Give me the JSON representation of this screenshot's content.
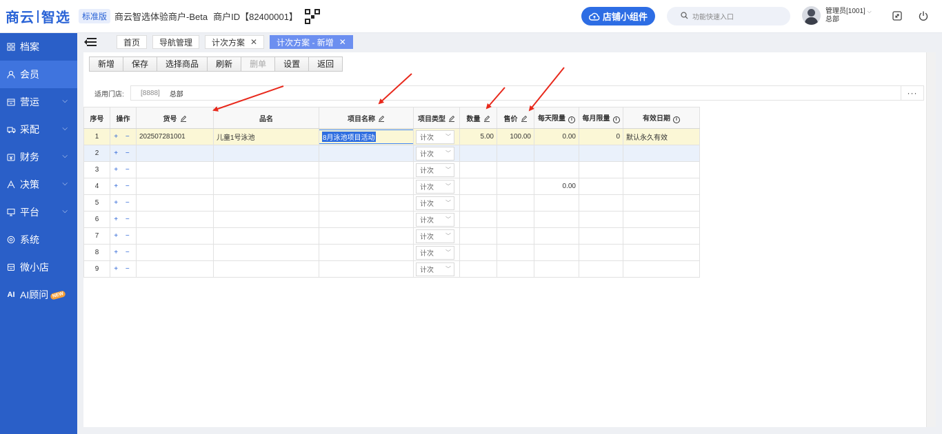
{
  "header": {
    "brand_left": "商云",
    "brand_right": "智选",
    "edition": "标准版",
    "merchant_name": "商云智选体验商户-Beta",
    "merchant_id": "商户ID【82400001】",
    "widget_button": "店铺小组件",
    "search_placeholder": "功能快速入口",
    "user_name": "管理员[1001]",
    "user_org": "总部"
  },
  "sidebar": {
    "items": [
      {
        "label": "档案",
        "icon": "archive-icon"
      },
      {
        "label": "会员",
        "icon": "member-icon"
      },
      {
        "label": "营运",
        "icon": "store-icon"
      },
      {
        "label": "采配",
        "icon": "truck-icon"
      },
      {
        "label": "财务",
        "icon": "wallet-icon"
      },
      {
        "label": "决策",
        "icon": "decision-icon"
      },
      {
        "label": "平台",
        "icon": "monitor-icon"
      },
      {
        "label": "系统",
        "icon": "gear-icon"
      },
      {
        "label": "微小店",
        "icon": "shop-icon"
      },
      {
        "label": "AI顾问",
        "icon": "ai-icon"
      }
    ],
    "new_badge": "NEW"
  },
  "tabs": [
    {
      "label": "首页"
    },
    {
      "label": "导航管理"
    },
    {
      "label": "计次方案"
    },
    {
      "label": "计次方案 - 新增"
    }
  ],
  "toolbar": {
    "buttons": [
      "新增",
      "保存",
      "选择商品",
      "刷新",
      "删单",
      "设置",
      "返回"
    ]
  },
  "store": {
    "label": "适用门店:",
    "code": "[8888]",
    "name": "总部",
    "more": "···"
  },
  "table": {
    "headers": [
      "序号",
      "操作",
      "货号",
      "品名",
      "项目名称",
      "项目类型",
      "数量",
      "售价",
      "每天限量",
      "每月限量",
      "有效日期"
    ],
    "ops": "+ −",
    "type_value": "计次",
    "rows": [
      {
        "no": "1",
        "sku": "202507281001",
        "name": "儿童1号泳池",
        "project": "8月泳池项目活动",
        "qty": "5.00",
        "price": "100.00",
        "daily": "0.00",
        "monthly": "0",
        "valid": "默认永久有效"
      },
      {
        "no": "2",
        "sku": "",
        "name": "",
        "project": "",
        "qty": "",
        "price": "",
        "daily": "",
        "monthly": "",
        "valid": ""
      },
      {
        "no": "3",
        "sku": "",
        "name": "",
        "project": "",
        "qty": "",
        "price": "",
        "daily": "",
        "monthly": "",
        "valid": ""
      },
      {
        "no": "4",
        "sku": "",
        "name": "",
        "project": "",
        "qty": "",
        "price": "",
        "daily": "0.00",
        "monthly": "",
        "valid": ""
      },
      {
        "no": "5",
        "sku": "",
        "name": "",
        "project": "",
        "qty": "",
        "price": "",
        "daily": "",
        "monthly": "",
        "valid": ""
      },
      {
        "no": "6",
        "sku": "",
        "name": "",
        "project": "",
        "qty": "",
        "price": "",
        "daily": "",
        "monthly": "",
        "valid": ""
      },
      {
        "no": "7",
        "sku": "",
        "name": "",
        "project": "",
        "qty": "",
        "price": "",
        "daily": "",
        "monthly": "",
        "valid": ""
      },
      {
        "no": "8",
        "sku": "",
        "name": "",
        "project": "",
        "qty": "",
        "price": "",
        "daily": "",
        "monthly": "",
        "valid": ""
      },
      {
        "no": "9",
        "sku": "",
        "name": "",
        "project": "",
        "qty": "",
        "price": "",
        "daily": "",
        "monthly": "",
        "valid": ""
      }
    ]
  },
  "colors": {
    "brand": "#2a63d6",
    "sidebar": "#2a5fc8",
    "active_tab": "#6c8ff0",
    "annotation_arrow": "#e8291c",
    "selected_row": "#fbf7d6"
  }
}
